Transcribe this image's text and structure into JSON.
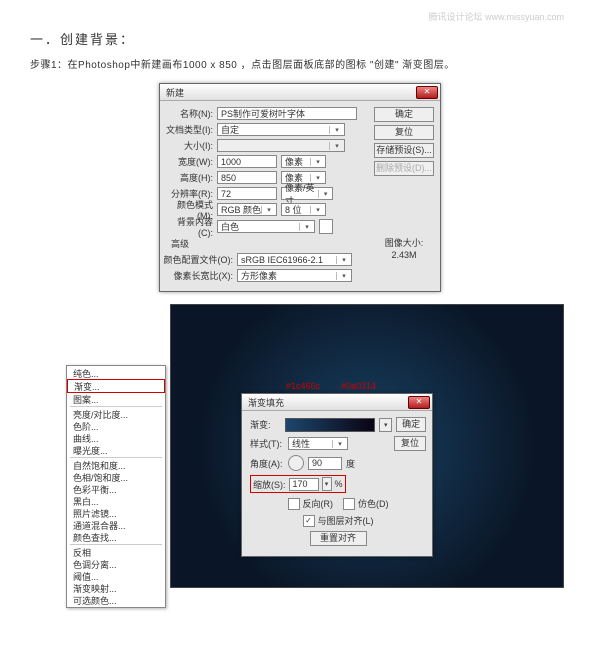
{
  "watermark": "腾讯设计论坛  www.missyuan.com",
  "heading": "一．创建背景：",
  "step1": "步骤1：在Photoshop中新建画布1000 x 850 ，点击图层面板底部的图标 \"创建\" 渐变图层。",
  "new_dialog": {
    "title": "新建",
    "btn_ok": "确定",
    "btn_cancel": "复位",
    "btn_save_preset": "存储预设(S)...",
    "btn_del_preset": "删除预设(D)...",
    "name_lbl": "名称(N):",
    "name_val": "PS制作可爱树叶字体",
    "preset_lbl": "文档类型(I):",
    "preset_val": "自定",
    "size_lbl": "大小(I):",
    "width_lbl": "宽度(W):",
    "width_val": "1000",
    "width_unit": "像素",
    "height_lbl": "高度(H):",
    "height_val": "850",
    "height_unit": "像素",
    "res_lbl": "分辨率(R):",
    "res_val": "72",
    "res_unit": "像素/英寸",
    "mode_lbl": "颜色模式(M):",
    "mode_val": "RGB 颜色",
    "depth_val": "8 位",
    "bg_lbl": "背景内容(C):",
    "bg_val": "白色",
    "adv_lbl": "高级",
    "profile_lbl": "颜色配置文件(O):",
    "profile_val": "sRGB IEC61966-2.1",
    "aspect_lbl": "像素长宽比(X):",
    "aspect_val": "方形像素",
    "imgsize_lbl": "图像大小:",
    "imgsize_val": "2.43M"
  },
  "annotations": {
    "a": "#1c466c",
    "b": "#0a0314"
  },
  "context_menu": {
    "items_a": [
      "纯色...",
      "渐变...",
      "图案..."
    ],
    "items_b": [
      "亮度/对比度...",
      "色阶...",
      "曲线...",
      "曝光度..."
    ],
    "items_c": [
      "自然饱和度...",
      "色相/饱和度...",
      "色彩平衡...",
      "黑白...",
      "照片滤镜...",
      "通道混合器...",
      "颜色查找..."
    ],
    "items_d": [
      "反相",
      "色调分离...",
      "阈值...",
      "渐变映射...",
      "可选颜色..."
    ]
  },
  "grad_dialog": {
    "title": "渐变填充",
    "btn_ok": "确定",
    "btn_cancel": "复位",
    "grad_lbl": "渐变:",
    "style_lbl": "样式(T):",
    "style_val": "线性",
    "angle_lbl": "角度(A):",
    "angle_val": "90",
    "angle_deg": "度",
    "scale_lbl": "缩放(S):",
    "scale_val": "170",
    "scale_pct": "%",
    "reverse_lbl": "反向(R)",
    "dither_lbl": "仿色(D)",
    "align_lbl": "与图层对齐(L)",
    "reset_align": "重置对齐"
  }
}
